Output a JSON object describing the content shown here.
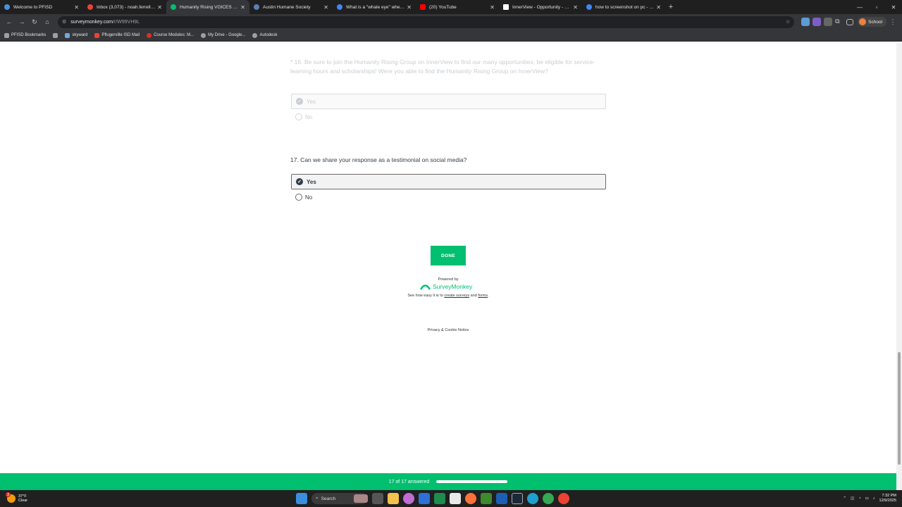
{
  "browser": {
    "tabs": [
      {
        "title": "Welcome to PFISD",
        "color": "#4a90d9",
        "active": false
      },
      {
        "title": "Inbox (3,073) - noah.ferrell@stu",
        "color": "#ea4335",
        "active": false
      },
      {
        "title": "Humanity Rising VOICES Survey",
        "color": "#00bf6f",
        "active": true
      },
      {
        "title": "Austin Humane Society",
        "color": "#5b7fb5",
        "active": false
      },
      {
        "title": "What is a \"whale eye\" when refe",
        "color": "#4285f4",
        "active": false
      },
      {
        "title": "(20) YouTube",
        "color": "#ff0000",
        "active": false
      },
      {
        "title": "InnerView - Opportunity - Mini",
        "color": "#ffffff",
        "active": false
      },
      {
        "title": "how to screenshot on pc - Goo",
        "color": "#4285f4",
        "active": false
      }
    ],
    "url_host": "surveymonkey.com",
    "url_path": "/r/W99VH9L",
    "profile_label": "School",
    "bookmarks": [
      {
        "label": "PFISD Bookmarks",
        "color": "#9aa0a6"
      },
      {
        "label": "",
        "color": "#9aa0a6"
      },
      {
        "label": "skyward",
        "color": "#6fa8dc"
      },
      {
        "label": "Pflugerville ISD Mail",
        "color": "#ea4335"
      },
      {
        "label": "Course Modules: M...",
        "color": "#d93025"
      },
      {
        "label": "My Drive - Google...",
        "color": "#9aa0a6"
      },
      {
        "label": "Autodesk",
        "color": "#9aa0a6"
      }
    ]
  },
  "survey": {
    "q16": {
      "text": "* 16. Be sure to join the Humanity Rising Group on InnerView to find our many opportunities, be eligible for service-learning hours and scholarships! Were you able to find the Humanity Rising Group on InnerView?",
      "options": [
        "Yes",
        "No"
      ],
      "selected": "Yes"
    },
    "q17": {
      "text": "17. Can we share your response as a testimonial on social media?",
      "options": [
        "Yes",
        "No"
      ],
      "selected": "Yes"
    },
    "done_label": "DONE",
    "powered_by": "Powered by",
    "brand": "SurveyMonkey",
    "tagline_prefix": "See how easy it is to",
    "link_surveys": "create surveys",
    "tagline_and": "and",
    "link_forms": "forms",
    "tagline_suffix": ".",
    "privacy": "Privacy & Cookie Notice",
    "progress_text": "17 of 17 answered",
    "progress_value": 1.0,
    "brand_color": "#00bf6f"
  },
  "taskbar": {
    "weather_temp": "37°F",
    "weather_cond": "Clear",
    "weather_badge": "3",
    "search_label": "Search",
    "time": "7:32 PM",
    "date": "12/9/2025"
  }
}
